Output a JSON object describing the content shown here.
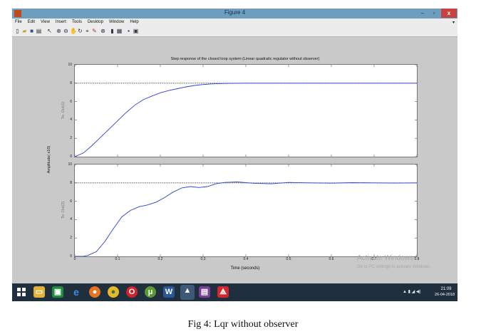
{
  "window": {
    "title": "Figure 4"
  },
  "window_controls": {
    "minimize": "–",
    "maximize": "▫",
    "close": "x"
  },
  "menubar": {
    "items": [
      "File",
      "Edit",
      "View",
      "Insert",
      "Tools",
      "Desktop",
      "Window",
      "Help"
    ]
  },
  "toolbar": {
    "icons": [
      "new-figure-icon",
      "open-file-icon",
      "save-icon",
      "print-icon",
      "edit-plot-icon",
      "zoom-in-icon",
      "zoom-out-icon",
      "pan-icon",
      "rotate-3d-icon",
      "data-cursor-icon",
      "brush-icon",
      "link-plot-icon",
      "insert-colorbar-icon",
      "insert-legend-icon",
      "hide-plot-tools-icon",
      "show-plot-tools-icon"
    ]
  },
  "figure": {
    "title": "Step response of the closed loop system (Linear quadratic regulator without observer)",
    "ylabel": "Amplitude( x10)",
    "xlabel": "Time (seconds)",
    "axes": [
      {
        "ylabel": "To: Out(1)"
      },
      {
        "ylabel": "To: Out(2)"
      }
    ]
  },
  "chart_data": {
    "type": "line",
    "title": "Step response of the closed loop system (Linear quadratic regulator without observer)",
    "xlabel": "Time (seconds)",
    "ylabel": "Amplitude( x10)",
    "xlim": [
      0,
      0.8
    ],
    "ylim": [
      0,
      10
    ],
    "x_ticks": [
      "0",
      "0.1",
      "0.2",
      "0.3",
      "0.4",
      "0.5",
      "0.6",
      "0.7",
      "0.8"
    ],
    "y_ticks": [
      "0",
      "2",
      "4",
      "6",
      "8",
      "10"
    ],
    "reference_level": 8,
    "grid": false,
    "subplots": [
      {
        "ylabel": "To: Out(1)",
        "x": [
          0,
          0.02,
          0.04,
          0.06,
          0.08,
          0.1,
          0.12,
          0.14,
          0.16,
          0.18,
          0.2,
          0.22,
          0.24,
          0.26,
          0.28,
          0.3,
          0.32,
          0.35,
          0.4,
          0.5,
          0.6,
          0.7,
          0.8
        ],
        "y": [
          0,
          0.4,
          1.2,
          2.1,
          3.0,
          3.9,
          4.8,
          5.6,
          6.2,
          6.6,
          6.95,
          7.2,
          7.4,
          7.6,
          7.75,
          7.85,
          7.92,
          7.97,
          8.0,
          8.0,
          8.0,
          8.0,
          8.0
        ]
      },
      {
        "ylabel": "To: Out(2)",
        "x": [
          0,
          0.02,
          0.03,
          0.05,
          0.07,
          0.09,
          0.11,
          0.13,
          0.15,
          0.17,
          0.19,
          0.21,
          0.23,
          0.25,
          0.27,
          0.29,
          0.31,
          0.33,
          0.35,
          0.38,
          0.42,
          0.46,
          0.5,
          0.55,
          0.6,
          0.65,
          0.7,
          0.75,
          0.8
        ],
        "y": [
          0,
          0,
          0.1,
          0.5,
          1.6,
          3.0,
          4.3,
          5.0,
          5.4,
          5.6,
          5.9,
          6.4,
          7.0,
          7.45,
          7.6,
          7.5,
          7.6,
          7.9,
          8.05,
          8.1,
          7.95,
          7.9,
          8.05,
          8.0,
          7.97,
          8.02,
          8.0,
          7.98,
          8.0
        ]
      }
    ]
  },
  "watermark": {
    "line1": "Activate Windows",
    "line2": "Go to PC settings to activate Windows."
  },
  "taskbar": {
    "apps": [
      "windows-start-icon",
      "file-explorer-icon",
      "store-icon",
      "internet-explorer-icon",
      "firefox-icon",
      "chrome-icon",
      "opera-icon",
      "utorrent-icon",
      "word-icon",
      "matlab-icon",
      "winrar-icon",
      "acrobat-icon"
    ],
    "tray": "▲ ▮ ◢ ◀)",
    "time": "21:09",
    "date": "26-04-2018"
  },
  "caption": "Fig 4: Lqr without observer"
}
